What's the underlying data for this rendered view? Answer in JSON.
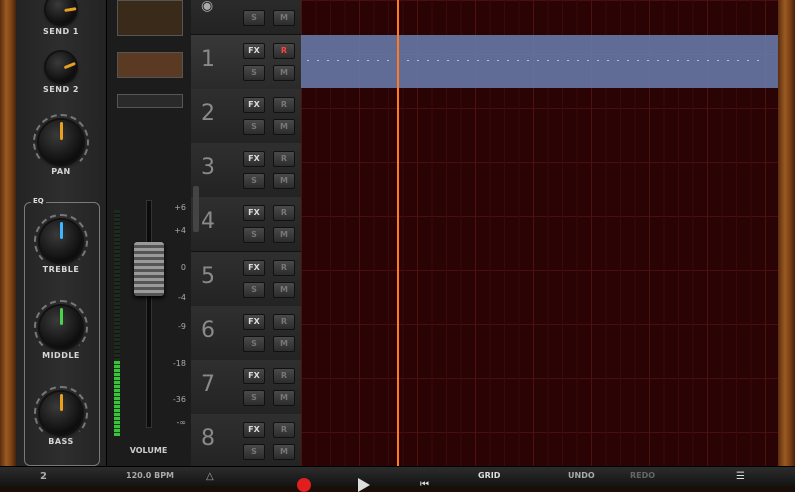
{
  "mixer": {
    "send1": {
      "label": "SEND 1",
      "value": 0.8
    },
    "send2": {
      "label": "SEND 2",
      "value": 0.75
    },
    "pan": {
      "label": "PAN",
      "value": 0.5
    },
    "eq": {
      "label": "EQ",
      "treble": {
        "label": "TREBLE",
        "value": 0.5
      },
      "middle": {
        "label": "MIDDLE",
        "value": 0.5
      },
      "bass": {
        "label": "BASS",
        "value": 0.5
      }
    },
    "volume_label": "VOLUME",
    "volume_scale": [
      "+6",
      "+4",
      "0",
      "-4",
      "-9",
      "-18",
      "-36",
      "-∞"
    ],
    "meter_level": 0.33,
    "fader_level": 0.7
  },
  "tracks": [
    {
      "number": "",
      "fx": "",
      "r": "",
      "s": "S",
      "m": "M",
      "armed": false,
      "selected": false
    },
    {
      "number": "1",
      "fx": "FX",
      "r": "R",
      "s": "S",
      "m": "M",
      "armed": true,
      "selected": true
    },
    {
      "number": "2",
      "fx": "FX",
      "r": "R",
      "s": "S",
      "m": "M",
      "armed": false,
      "selected": false
    },
    {
      "number": "3",
      "fx": "FX",
      "r": "R",
      "s": "S",
      "m": "M",
      "armed": false,
      "selected": false
    },
    {
      "number": "4",
      "fx": "FX",
      "r": "R",
      "s": "S",
      "m": "M",
      "armed": false,
      "selected": false
    },
    {
      "number": "5",
      "fx": "FX",
      "r": "R",
      "s": "S",
      "m": "M",
      "armed": false,
      "selected": false
    },
    {
      "number": "6",
      "fx": "FX",
      "r": "R",
      "s": "S",
      "m": "M",
      "armed": false,
      "selected": false
    },
    {
      "number": "7",
      "fx": "FX",
      "r": "R",
      "s": "S",
      "m": "M",
      "armed": false,
      "selected": false
    },
    {
      "number": "8",
      "fx": "FX",
      "r": "R",
      "s": "S",
      "m": "M",
      "armed": false,
      "selected": false
    }
  ],
  "transport": {
    "tempo": "120.0 BPM",
    "grid": "GRID",
    "undo": "UNDO",
    "redo": "REDO"
  },
  "colors": {
    "record": "#e01e1e",
    "playhead": "#ff7a20",
    "region": "#6a7fb0",
    "treble_indicator": "#3fb6ff",
    "middle_indicator": "#4ad24a",
    "knob_indicator": "#e8a020"
  }
}
